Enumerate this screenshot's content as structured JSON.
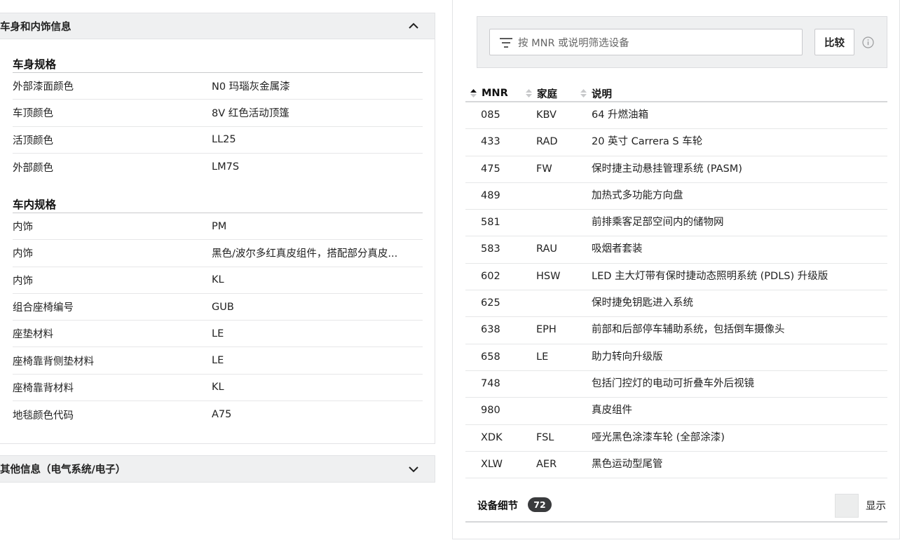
{
  "left_panel": {
    "body_interior": {
      "header_title": "车身和内饰信息",
      "body_specs": {
        "title": "车身规格",
        "rows": [
          {
            "label": "外部漆面颜色",
            "value": "N0 玛瑙灰金属漆"
          },
          {
            "label": "车顶颜色",
            "value": "8V 红色活动顶篷"
          },
          {
            "label": "活顶颜色",
            "value": "LL25"
          },
          {
            "label": "外部颜色",
            "value": "LM7S"
          }
        ]
      },
      "interior_specs": {
        "title": "车内规格",
        "rows": [
          {
            "label": "内饰",
            "value": "PM"
          },
          {
            "label": "内饰",
            "value": "黑色/波尔多红真皮组件，搭配部分真皮..."
          },
          {
            "label": "内饰",
            "value": "KL"
          },
          {
            "label": "组合座椅编号",
            "value": "GUB"
          },
          {
            "label": "座垫材料",
            "value": "LE"
          },
          {
            "label": "座椅靠背侧垫材料",
            "value": "LE"
          },
          {
            "label": "座椅靠背材料",
            "value": "KL"
          },
          {
            "label": "地毯颜色代码",
            "value": "A75"
          }
        ]
      }
    },
    "other_info": {
      "header_title": "其他信息（电气系统/电子）"
    }
  },
  "right_panel": {
    "filter": {
      "placeholder": "按 MNR 或说明筛选设备",
      "compare_label": "比较"
    },
    "columns": {
      "mnr": "MNR",
      "family": "家庭",
      "description": "说明"
    },
    "rows": [
      {
        "mnr": "085",
        "family": "KBV",
        "description": "64 升燃油箱"
      },
      {
        "mnr": "433",
        "family": "RAD",
        "description": "20 英寸 Carrera S 车轮"
      },
      {
        "mnr": "475",
        "family": "FW",
        "description": "保时捷主动悬挂管理系统 (PASM)"
      },
      {
        "mnr": "489",
        "family": "",
        "description": "加热式多功能方向盘"
      },
      {
        "mnr": "581",
        "family": "",
        "description": "前排乘客足部空间内的储物网"
      },
      {
        "mnr": "583",
        "family": "RAU",
        "description": "吸烟者套装"
      },
      {
        "mnr": "602",
        "family": "HSW",
        "description": "LED 主大灯带有保时捷动态照明系统 (PDLS) 升级版"
      },
      {
        "mnr": "625",
        "family": "",
        "description": "保时捷免钥匙进入系统"
      },
      {
        "mnr": "638",
        "family": "EPH",
        "description": "前部和后部停车辅助系统，包括倒车摄像头"
      },
      {
        "mnr": "658",
        "family": "LE",
        "description": "助力转向升级版"
      },
      {
        "mnr": "748",
        "family": "",
        "description": "包括门控灯的电动可折叠车外后视镜"
      },
      {
        "mnr": "980",
        "family": "",
        "description": "真皮组件"
      },
      {
        "mnr": "XDK",
        "family": "FSL",
        "description": "哑光黑色涂漆车轮 (全部涂漆)"
      },
      {
        "mnr": "XLW",
        "family": "AER",
        "description": "黑色运动型尾管"
      }
    ],
    "footer": {
      "title": "设备细节",
      "count": "72",
      "show_label": "显示"
    }
  }
}
